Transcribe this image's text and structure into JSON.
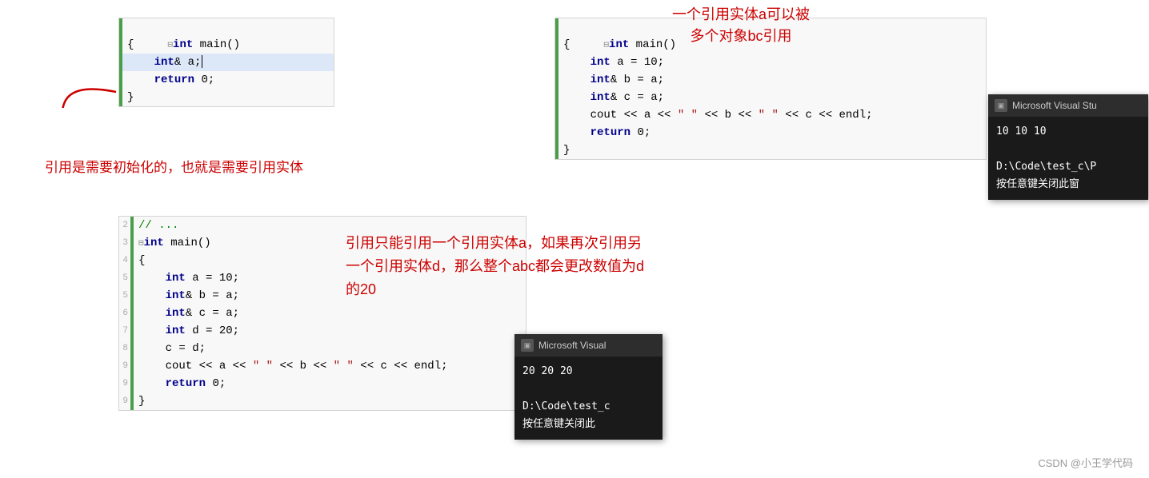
{
  "topLeft": {
    "lines": [
      {
        "gutter": "",
        "hasGreenBar": true,
        "indent": 0,
        "text": "int main()",
        "hasCollapse": true
      },
      {
        "gutter": "",
        "hasGreenBar": true,
        "indent": 0,
        "text": "{"
      },
      {
        "gutter": "",
        "hasGreenBar": true,
        "indent": 1,
        "text": "int& a;",
        "highlighted": true
      },
      {
        "gutter": "",
        "hasGreenBar": true,
        "indent": 1,
        "text": "return 0;"
      },
      {
        "gutter": "",
        "hasGreenBar": true,
        "indent": 0,
        "text": "}"
      }
    ],
    "annotation": "引用是需要初始化的，也就是需要引用实体",
    "arrowText": "→"
  },
  "topRight": {
    "lines": [
      {
        "text": "int main()",
        "hasCollapse": true
      },
      {
        "text": "{"
      },
      {
        "text": "    int a = 10;"
      },
      {
        "text": "    int& b = a;"
      },
      {
        "text": "    int& c = a;"
      },
      {
        "text": "    cout << a << \" \" << b << \" \" << c << endl;"
      },
      {
        "text": "    return 0;"
      },
      {
        "text": "}"
      }
    ],
    "annotation1": "一个引用实体a可以被",
    "annotation2": "多个对象bc引用"
  },
  "terminal1": {
    "title": "Microsoft Visual Stu",
    "lines": [
      "10 10 10",
      "",
      "D:\\Code\\test_c\\P",
      "按任意键关闭此窗"
    ]
  },
  "bottomLeft": {
    "gutters": [
      "2",
      "3",
      "4",
      "5",
      "6",
      "7",
      "8",
      "9",
      "9",
      "9"
    ],
    "lines": [
      {
        "text": "// ..."
      },
      {
        "text": "int main()",
        "hasCollapse": true
      },
      {
        "text": "{"
      },
      {
        "text": "    int a = 10;"
      },
      {
        "text": "    int& b = a;"
      },
      {
        "text": "    int& c = a;"
      },
      {
        "text": "    int d = 20;"
      },
      {
        "text": "    c = d;"
      },
      {
        "text": "    cout << a << \" \" << b << \" \" << c << endl;"
      },
      {
        "text": "    return 0;"
      },
      {
        "text": "}"
      }
    ]
  },
  "bottomAnnotation": {
    "line1": "引用只能引用一个引用实体a，如果再次引用另",
    "line2": "一个引用实体d，那么整个abc都会更改数值为d",
    "line3": "的20"
  },
  "terminal2": {
    "title": "Microsoft Visual",
    "lines": [
      "20 20 20",
      "",
      "D:\\Code\\test_c",
      "按任意键关闭此"
    ]
  },
  "watermark": "CSDN @小王学代码"
}
